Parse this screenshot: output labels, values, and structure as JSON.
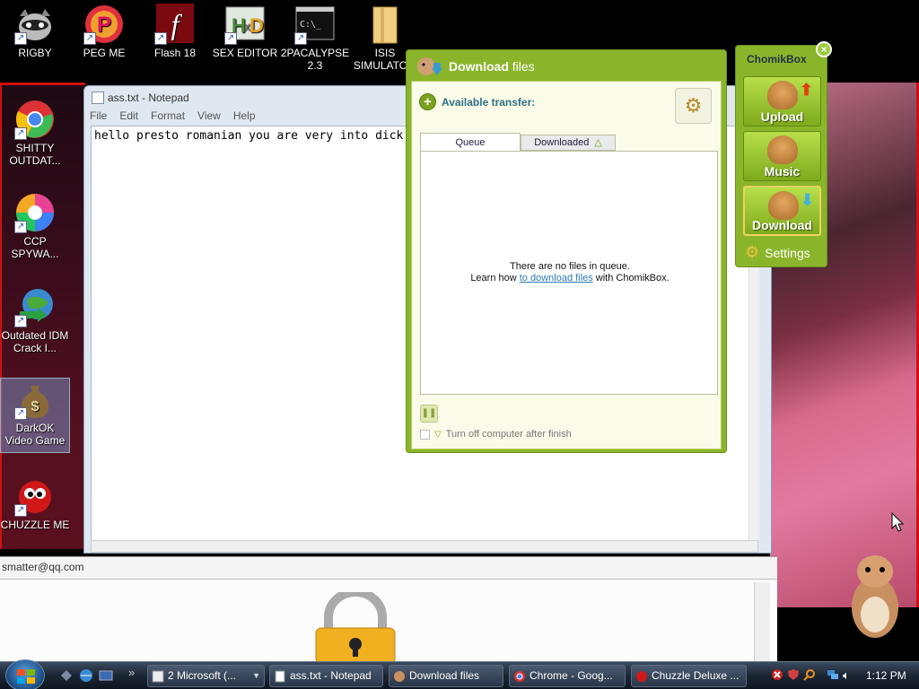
{
  "desktop_icons": [
    {
      "label": "RIGBY"
    },
    {
      "label": "PEG ME"
    },
    {
      "label": "Flash 18"
    },
    {
      "label": "SEX EDITOR"
    },
    {
      "label": "2PACALYPSE 2.3"
    },
    {
      "label": "ISIS SIMULATO..."
    },
    {
      "label": "SHITTY OUTDAT..."
    },
    {
      "label": "CCP SPYWA..."
    },
    {
      "label": "Outdated IDM Crack I..."
    },
    {
      "label": "DarkOK Video Game"
    },
    {
      "label": "CHUZZLE ME"
    }
  ],
  "notepad": {
    "title": "ass.txt - Notepad",
    "menu": [
      "File",
      "Edit",
      "Format",
      "View",
      "Help"
    ],
    "content": "hello presto romanian you are very into dick"
  },
  "lower_window": {
    "email_text": "smatter@qq.com"
  },
  "download_window": {
    "title_bold": "Download",
    "title_rest": "files",
    "available_label": "Available transfer:",
    "tabs": [
      "Queue",
      "Downloaded"
    ],
    "empty_line1": "There are no files in queue.",
    "empty_line2_pre": "Learn how ",
    "empty_line2_link": "to download files",
    "empty_line2_post": " with ChomikBox.",
    "shutdown_label": "Turn off computer after finish"
  },
  "chomikbox": {
    "title": "ChomikBox",
    "buttons": [
      "Upload",
      "Music",
      "Download"
    ],
    "settings_label": "Settings"
  },
  "taskbar": {
    "items": [
      "2 Microsoft (...",
      "ass.txt - Notepad",
      "Download files",
      "Chrome - Goog...",
      "Chuzzle Deluxe ..."
    ],
    "clock": "1:12 PM"
  },
  "colors": {
    "chomik_green": "#8ab52a",
    "link_blue": "#2a7ab0",
    "desktop_border_red": "#d01010"
  }
}
